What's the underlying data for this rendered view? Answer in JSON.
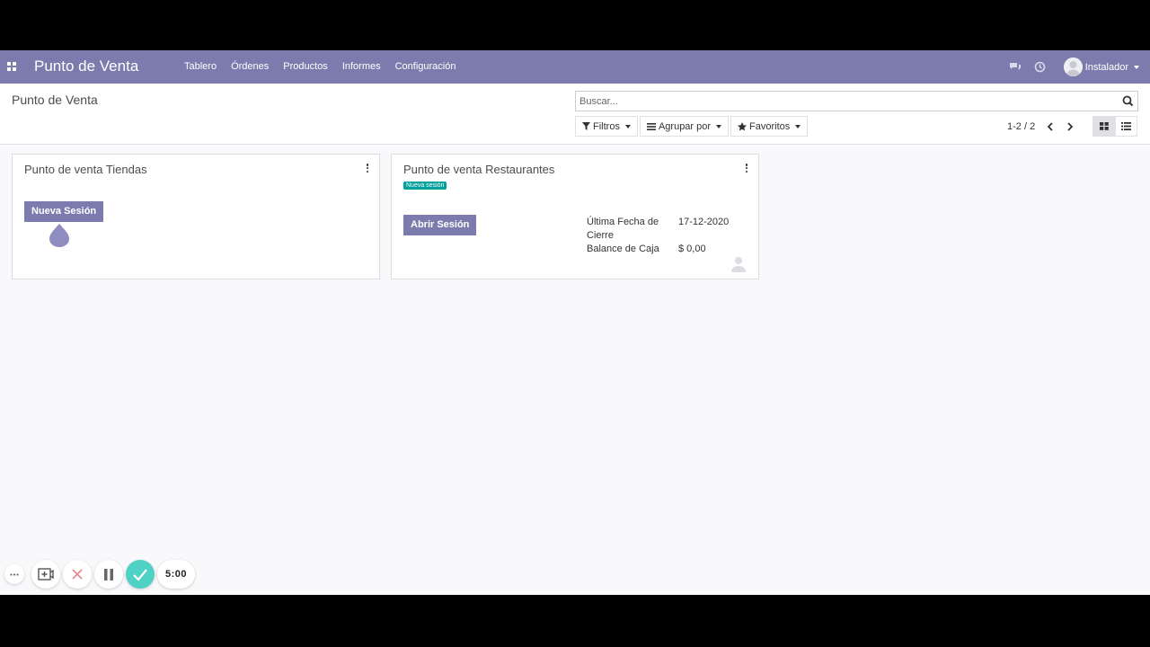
{
  "navbar": {
    "app_title": "Punto de Venta",
    "menu": [
      "Tablero",
      "Órdenes",
      "Productos",
      "Informes",
      "Configuración"
    ],
    "user": "Instalador",
    "bg_color": "#7c7bad"
  },
  "control_panel": {
    "breadcrumb": "Punto de Venta",
    "search_placeholder": "Buscar...",
    "filters": [
      {
        "label": "Filtros",
        "icon": "filter-icon"
      },
      {
        "label": "Agrupar por",
        "icon": "bars-icon"
      },
      {
        "label": "Favoritos",
        "icon": "star-icon"
      }
    ],
    "pager": "1-2 / 2"
  },
  "cards": [
    {
      "title": "Punto de venta Tiendas",
      "button": "Nueva Sesión"
    },
    {
      "title": "Punto de venta Restaurantes",
      "badge": "Nueva sesión",
      "button": "Abrir Sesión",
      "info": [
        {
          "label_line1": "Última Fecha de",
          "label_line2": "Cierre",
          "value": "17-12-2020"
        },
        {
          "label_line1": "Balance de Caja",
          "value": "$ 0,00"
        }
      ]
    }
  ],
  "recorder": {
    "timer": "5:00",
    "check_color": "#4fd1c5"
  }
}
